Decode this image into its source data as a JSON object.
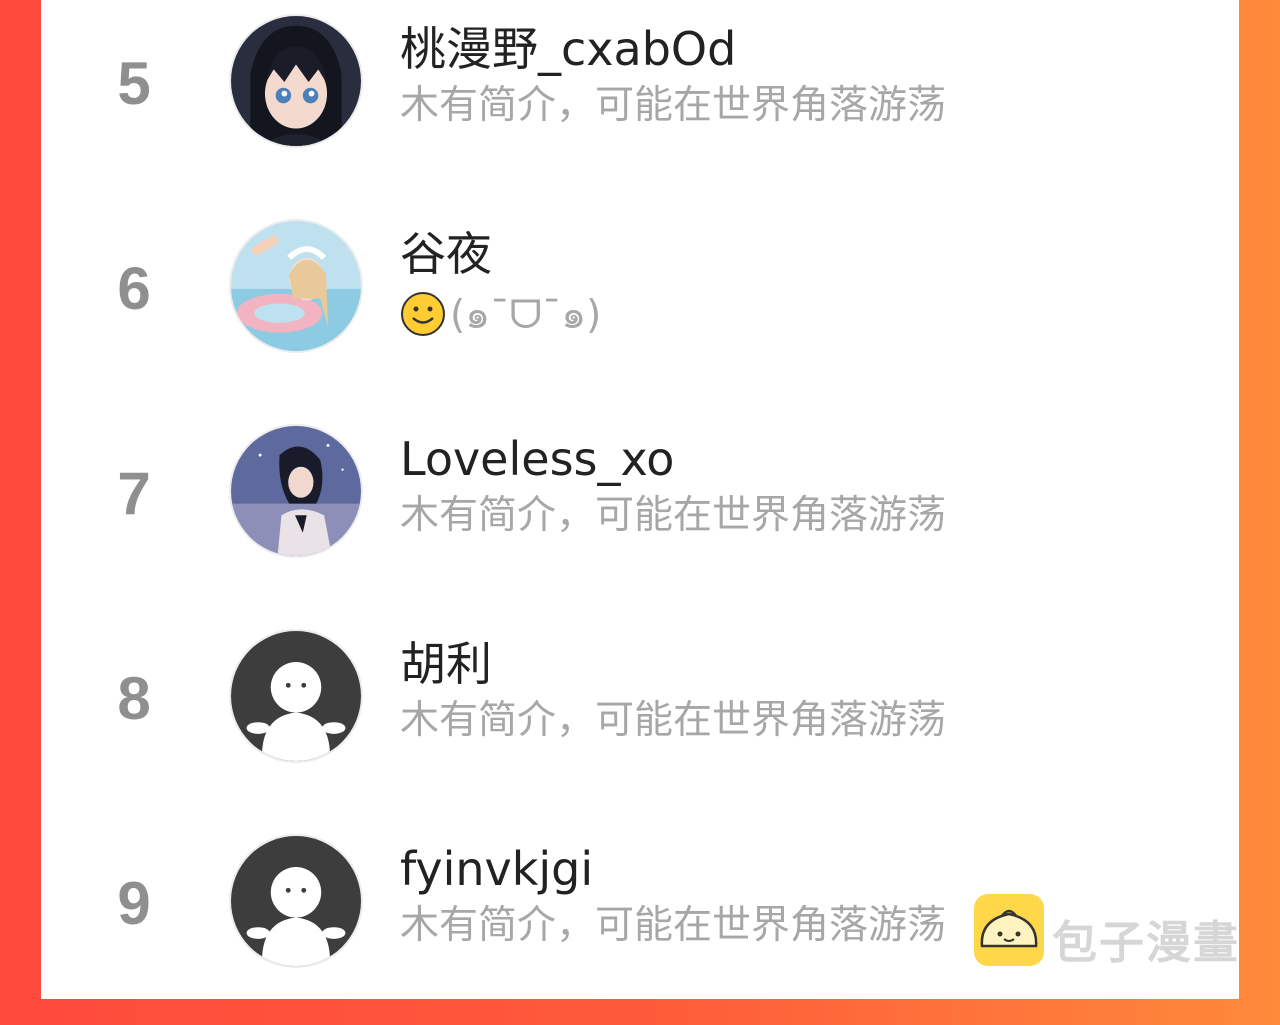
{
  "ranking": [
    {
      "rank": "5",
      "name": "桃漫野_cxabOd",
      "bio": "木有简介，可能在世界角落游荡",
      "avatar": "anime-girl-dark-hair-avatar"
    },
    {
      "rank": "6",
      "name": "谷夜",
      "bio_emoji": "🙂",
      "bio": "(๑¯ᗜ¯๑)",
      "avatar": "anime-girl-swimsuit-avatar"
    },
    {
      "rank": "7",
      "name": "Loveless_xo",
      "bio": "木有简介，可能在世界角落游荡",
      "avatar": "girl-night-sky-avatar"
    },
    {
      "rank": "8",
      "name": "胡利",
      "bio": "木有简介，可能在世界角落游荡",
      "avatar": "default-user-avatar"
    },
    {
      "rank": "9",
      "name": "fyinvkjgi",
      "bio": "木有简介，可能在世界角落游荡",
      "avatar": "default-user-avatar"
    }
  ],
  "watermark": {
    "text": "包子漫畫",
    "icon": "bun-mascot-icon"
  },
  "colors": {
    "frame_left": "#ff4a3d",
    "frame_right": "#ff8a3a",
    "rank": "#8f8f8f",
    "bio": "#a7a7a7",
    "watermark_icon": "#ffd84a"
  }
}
